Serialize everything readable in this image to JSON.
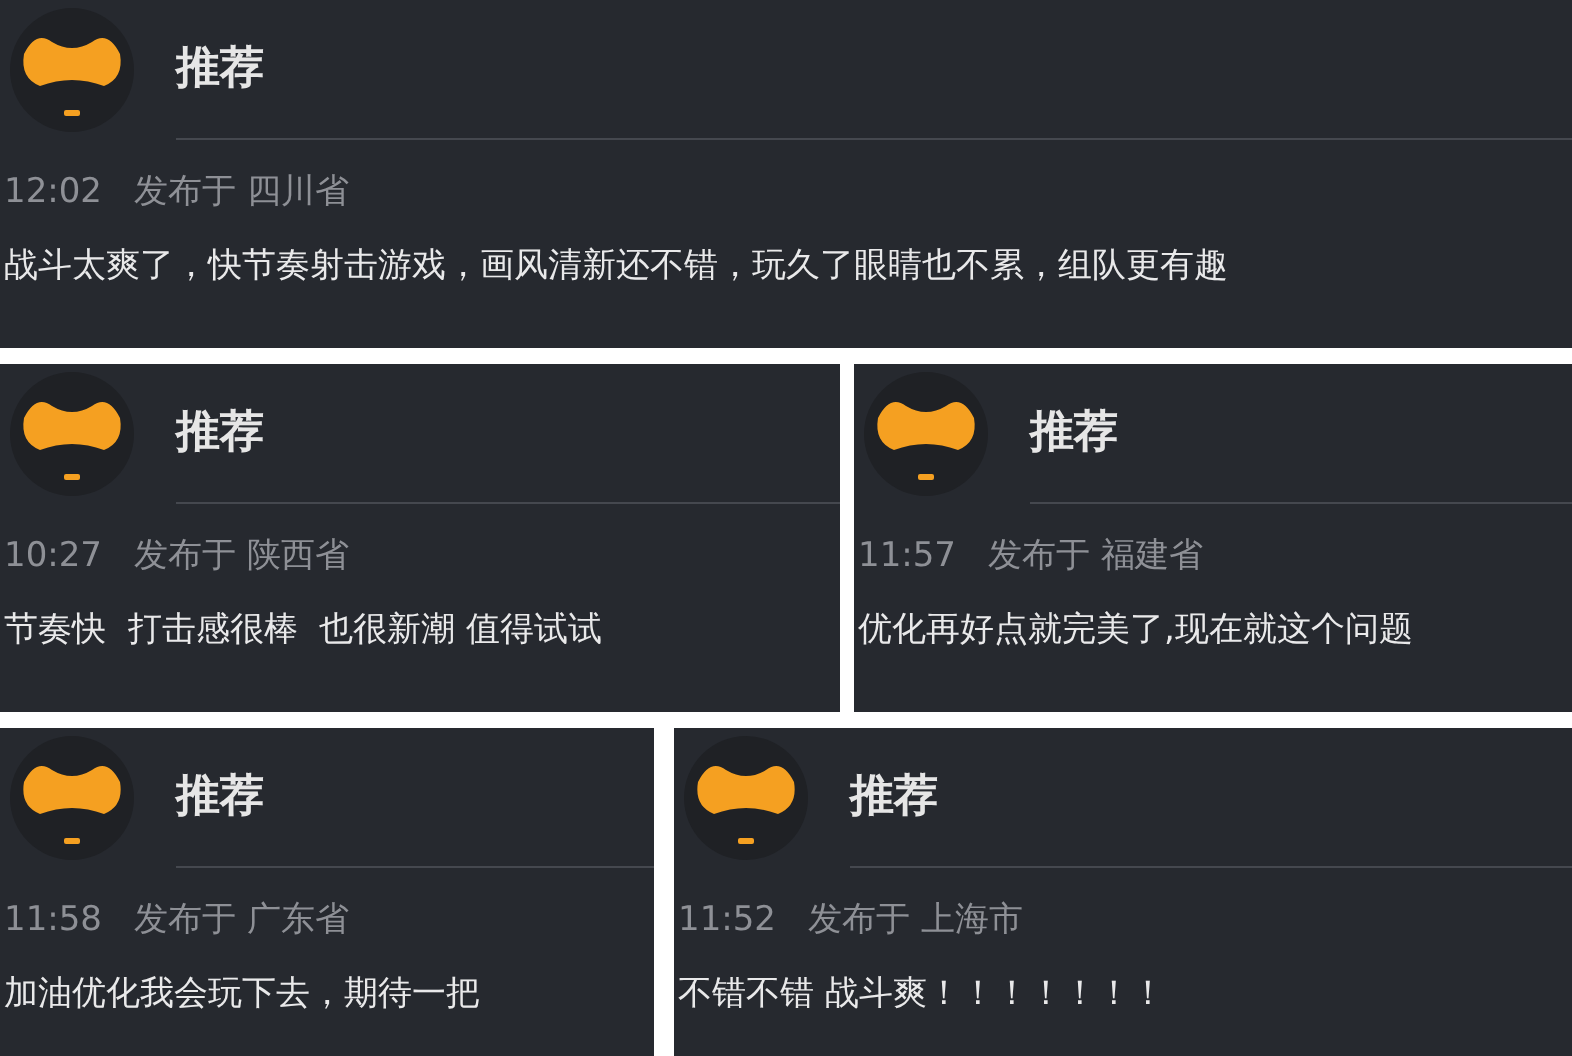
{
  "cards": [
    {
      "title": "推荐",
      "time": "12:02",
      "location": "发布于 四川省",
      "body": "战斗太爽了，快节奏射击游戏，画风清新还不错，玩久了眼睛也不累，组队更有趣"
    },
    {
      "title": "推荐",
      "time": "10:27",
      "location": "发布于 陕西省",
      "body": "节奏快  打击感很棒  也很新潮 值得试试"
    },
    {
      "title": "推荐",
      "time": "11:57",
      "location": "发布于 福建省",
      "body": "优化再好点就完美了,现在就这个问题"
    },
    {
      "title": "推荐",
      "time": "11:58",
      "location": "发布于 广东省",
      "body": "加油优化我会玩下去，期待一把"
    },
    {
      "title": "推荐",
      "time": "11:52",
      "location": "发布于 上海市",
      "body": "不错不错 战斗爽！！！！！！！"
    }
  ]
}
